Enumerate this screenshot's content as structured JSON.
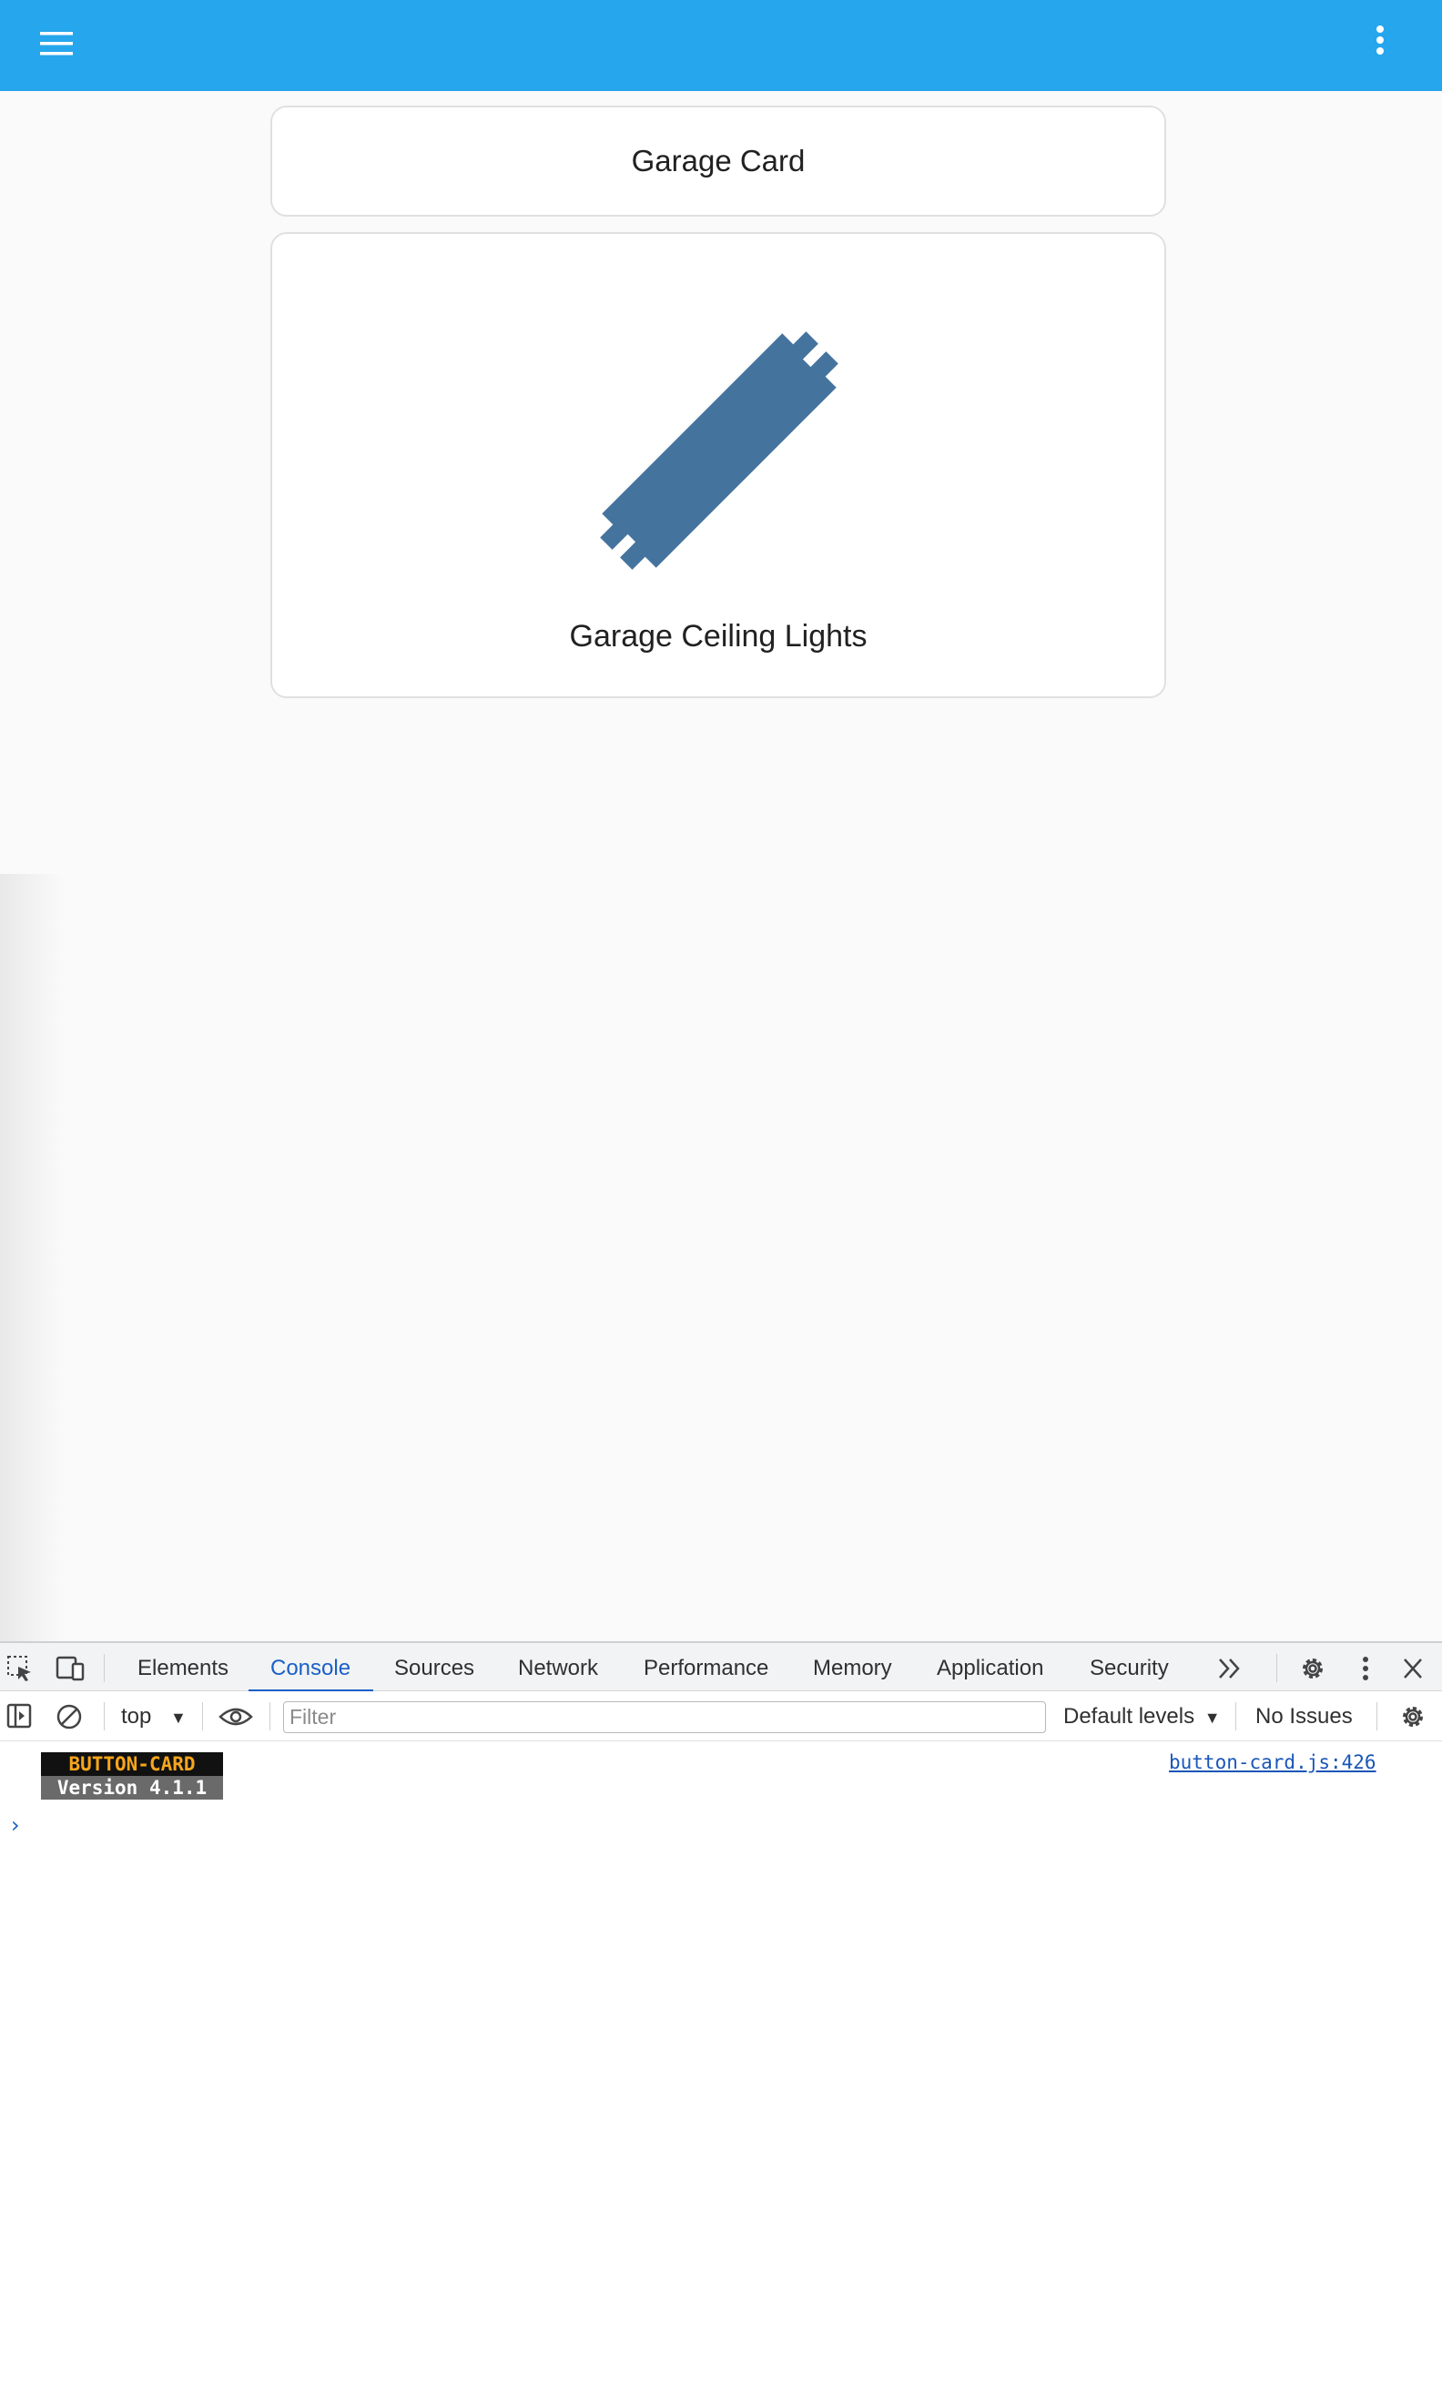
{
  "app": {
    "header_card_title": "Garage Card",
    "button_card_name": "Garage Ceiling Lights",
    "icons": {
      "menu": "menu-icon",
      "more": "more-vertical-icon",
      "entity": "light-tube-icon"
    },
    "colors": {
      "topbar": "#26a6ec",
      "entity_icon": "#44739e",
      "background": "#fafafa"
    }
  },
  "devtools": {
    "tabs": [
      {
        "label": "Elements"
      },
      {
        "label": "Console"
      },
      {
        "label": "Sources"
      },
      {
        "label": "Network"
      },
      {
        "label": "Performance"
      },
      {
        "label": "Memory"
      },
      {
        "label": "Application"
      },
      {
        "label": "Security"
      }
    ],
    "active_tab": "Console",
    "context": "top",
    "filter_placeholder": "Filter",
    "levels_label": "Default levels",
    "issues_label": "No Issues",
    "log": {
      "badge_line1": "BUTTON-CARD",
      "badge_line2": "Version 4.1.1",
      "source": "button-card.js:426"
    }
  }
}
